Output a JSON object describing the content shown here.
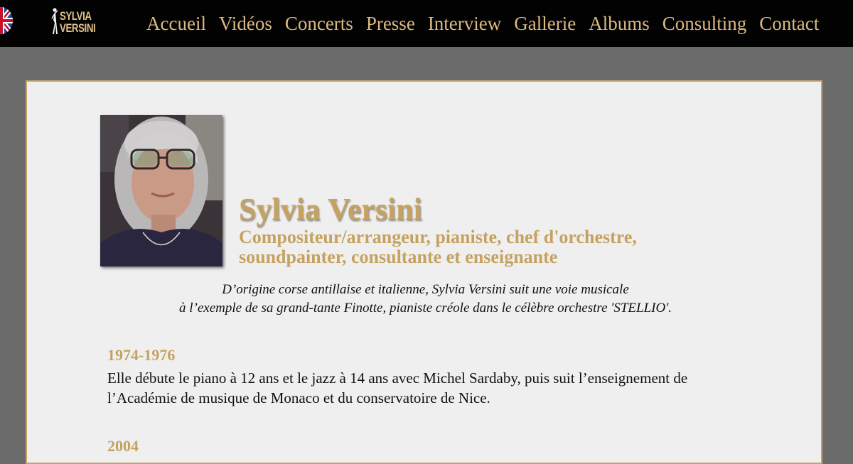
{
  "header": {
    "language_icon": "uk-flag-icon",
    "logo": {
      "line1": "SYLVIA",
      "line2": "VERSINI"
    },
    "nav": [
      {
        "label": "Accueil"
      },
      {
        "label": "Vidéos"
      },
      {
        "label": "Concerts"
      },
      {
        "label": "Presse"
      },
      {
        "label": "Interview"
      },
      {
        "label": "Gallerie"
      },
      {
        "label": "Albums"
      },
      {
        "label": "Consulting"
      },
      {
        "label": "Contact"
      }
    ],
    "colors": {
      "background": "#020202",
      "link": "#dcb97f"
    }
  },
  "profile": {
    "name": "Sylvia Versini",
    "subtitle": "Compositeur/arrangeur, pianiste, chef d'orchestre, soundpainter, consultante et enseignante",
    "intro_line1": "D’origine corse antillaise et italienne, Sylvia Versini suit une voie musicale",
    "intro_line2": "à l’exemple de sa grand-tante Finotte, pianiste créole dans le célèbre orchestre 'STELLIO'."
  },
  "timeline": [
    {
      "year": "1974-1976",
      "text": "Elle débute le piano à 12 ans et le jazz à 14 ans avec Michel Sardaby, puis suit l’enseignement de l’Académie de musique de Monaco et du conservatoire de Nice."
    },
    {
      "year": "2004"
    }
  ],
  "colors": {
    "page_background": "#6b6b6b",
    "panel": "#efefef",
    "accent": "#c6a261"
  }
}
